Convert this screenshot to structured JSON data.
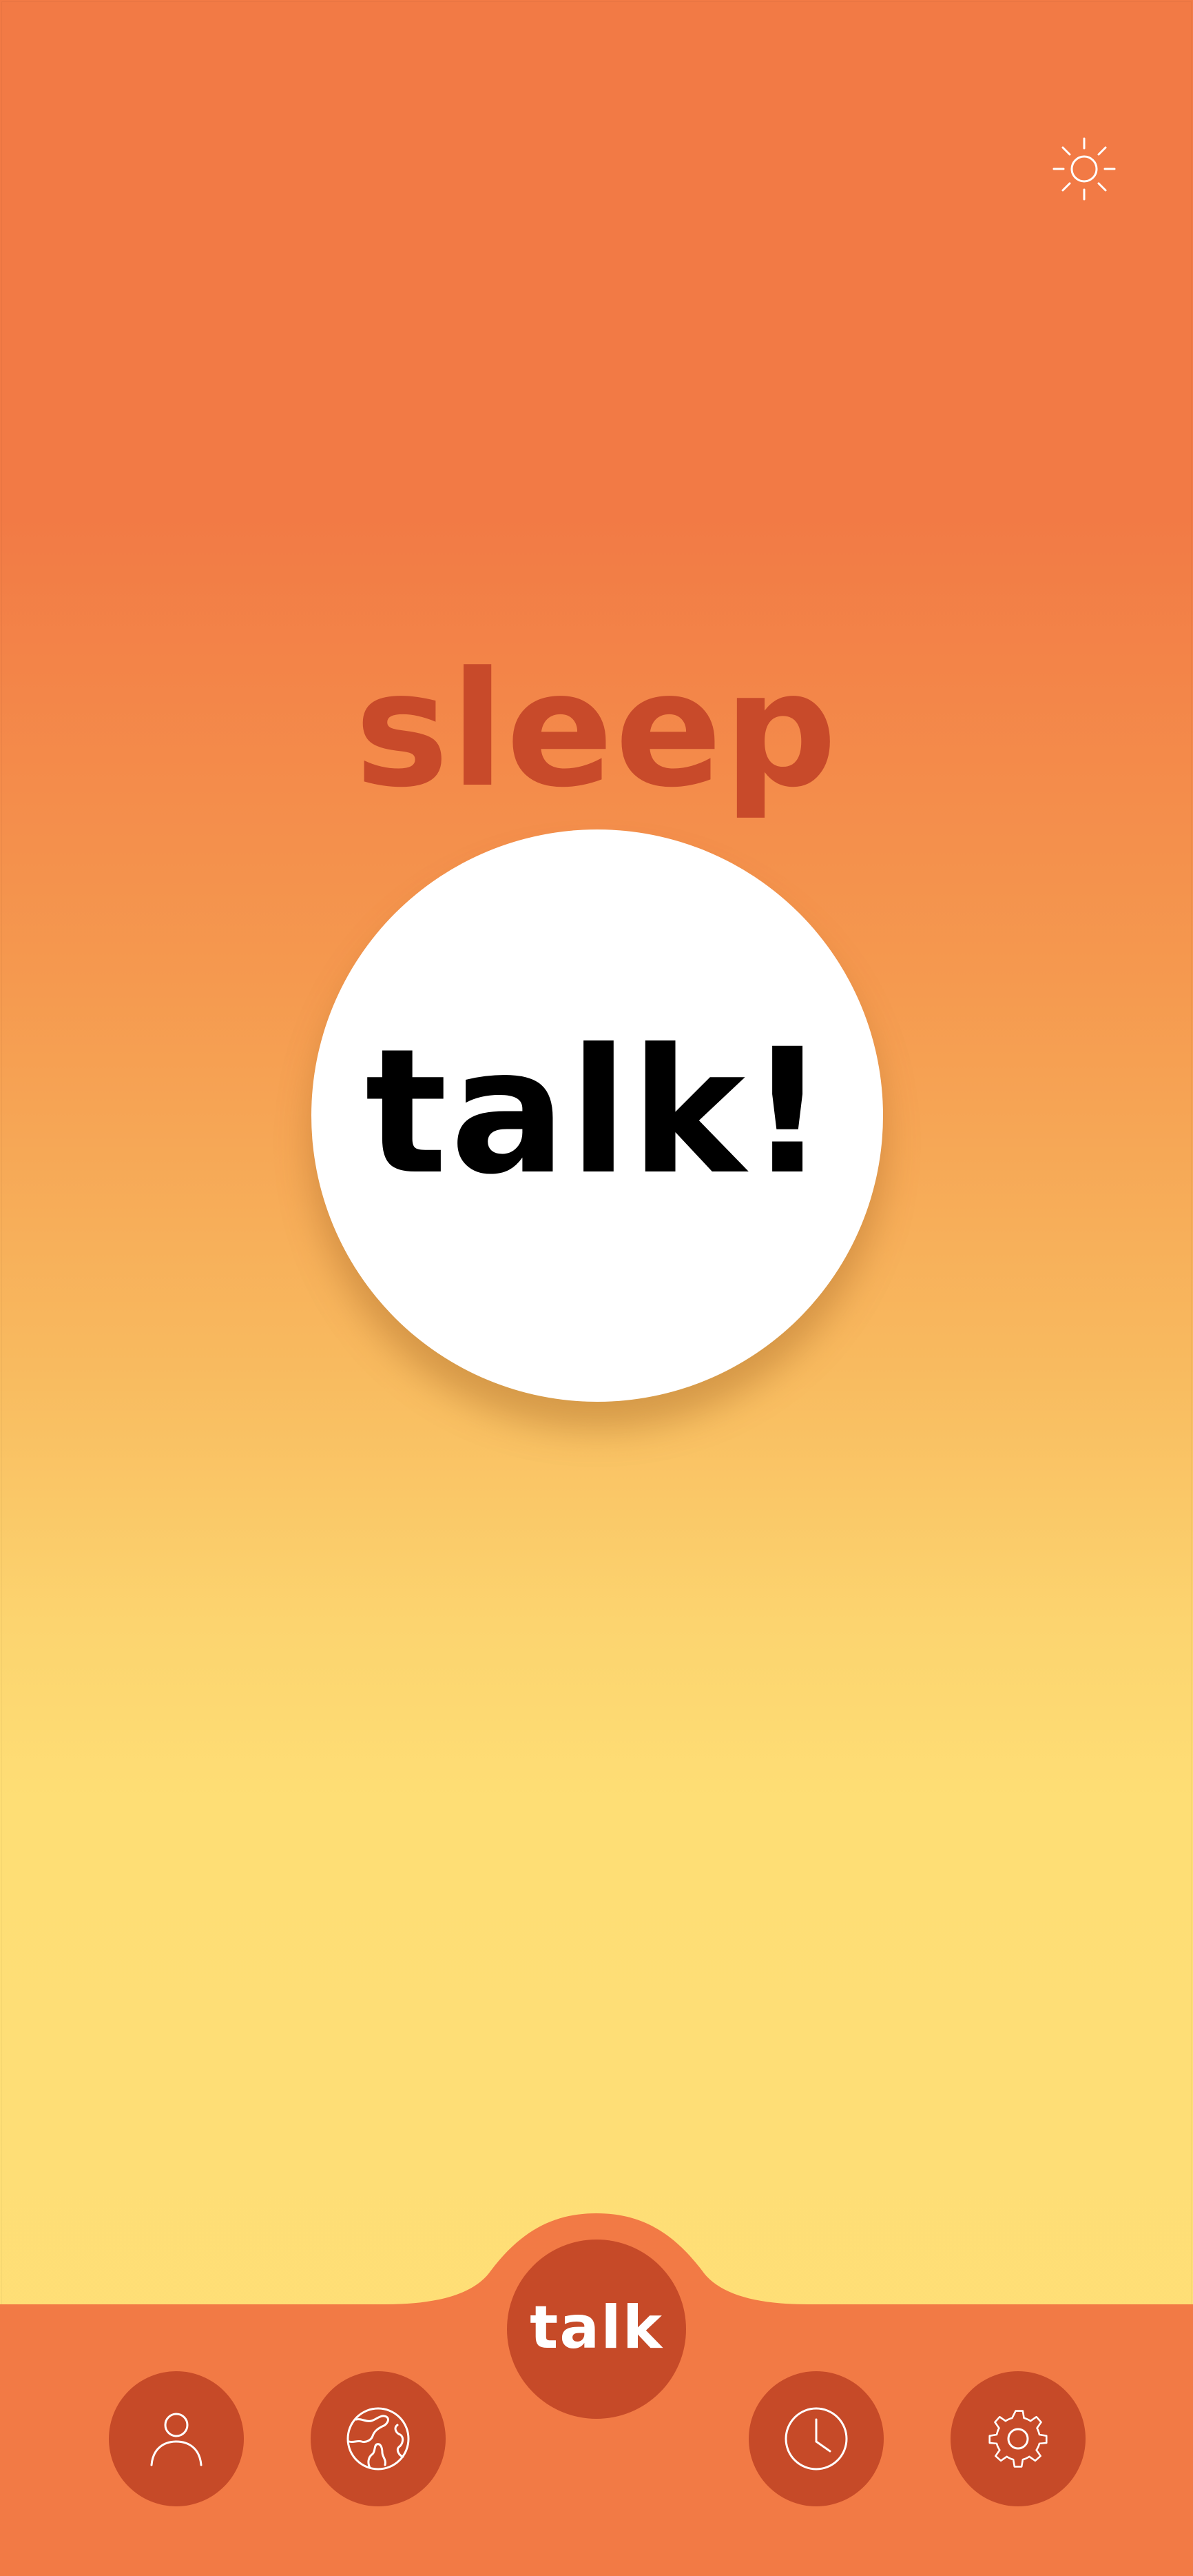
{
  "screen": {
    "title": "sleep"
  },
  "main_button": {
    "label": "talk!"
  },
  "bottom_nav": {
    "center_label": "talk",
    "items": [
      {
        "icon": "person-icon"
      },
      {
        "icon": "globe-icon"
      },
      {
        "icon": "clock-icon"
      },
      {
        "icon": "gear-icon"
      }
    ]
  },
  "header": {
    "theme_toggle_icon": "sun-icon"
  },
  "colors": {
    "accent": "#c64a28",
    "nav_background": "#f27a45",
    "gradient_top": "#f27a45",
    "gradient_bottom": "#ffdf77",
    "title_color": "#c84a2a"
  }
}
